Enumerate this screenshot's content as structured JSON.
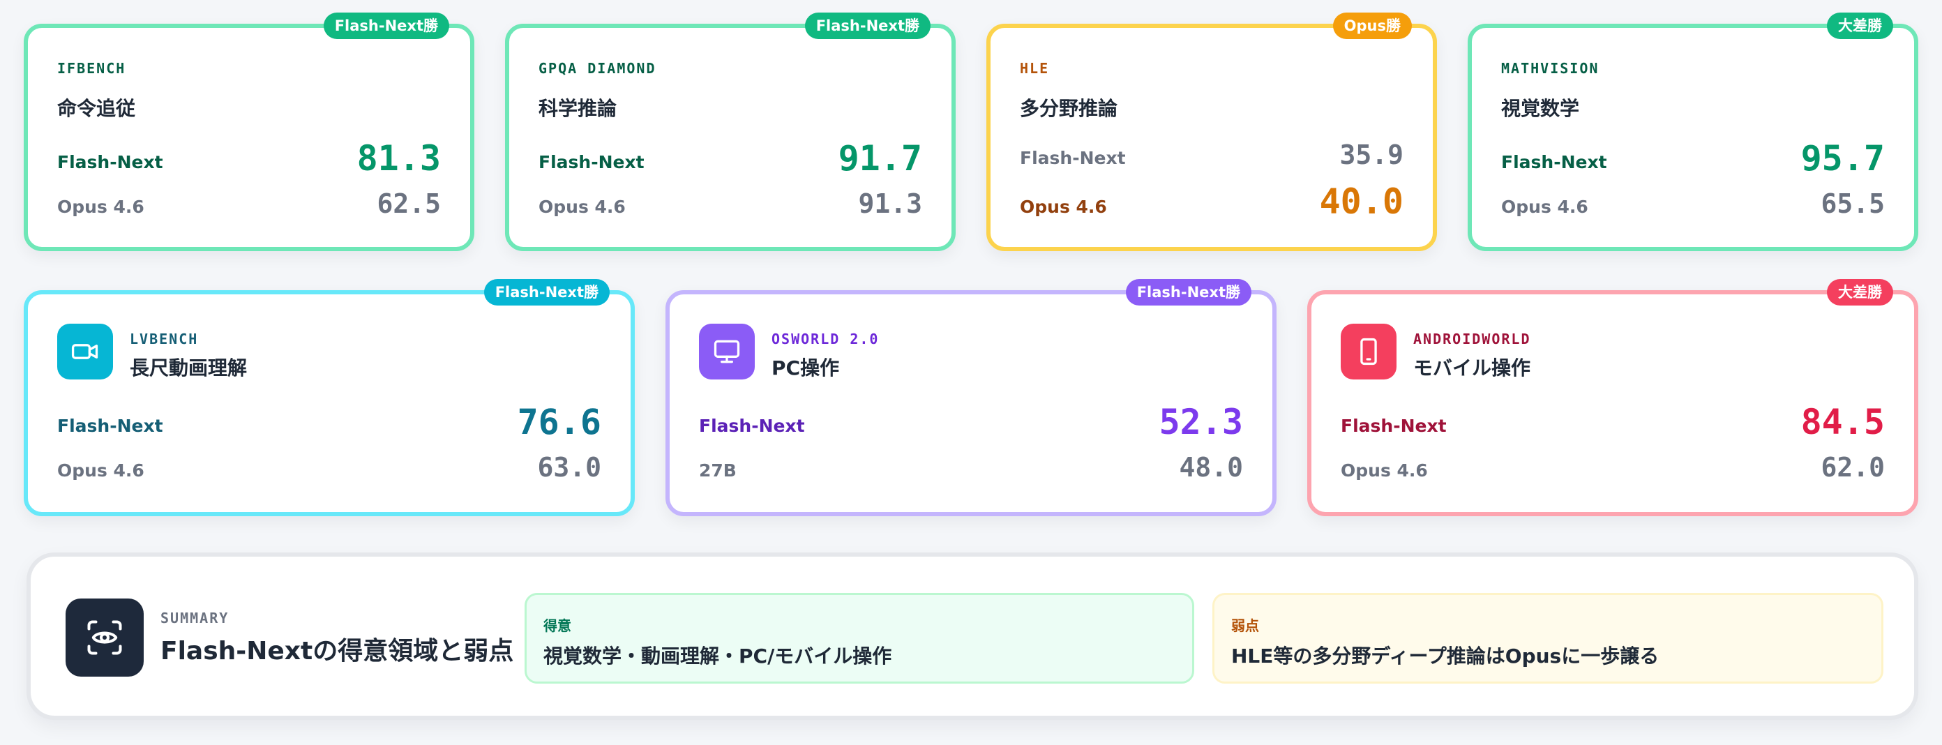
{
  "colors": {
    "green": "#10b981",
    "amber": "#f59e0b",
    "cyan": "#06b6d4",
    "purple": "#8b5cf6",
    "rose": "#f43f5e",
    "navy": "#1e293b"
  },
  "row1": [
    {
      "badge": "Flash-Next勝",
      "tag": "IFBENCH",
      "title": "命令追従",
      "rows": [
        {
          "label": "Flash-Next",
          "value": "81.3"
        },
        {
          "label": "Opus 4.6",
          "value": "62.5"
        }
      ]
    },
    {
      "badge": "Flash-Next勝",
      "tag": "GPQA DIAMOND",
      "title": "科学推論",
      "rows": [
        {
          "label": "Flash-Next",
          "value": "91.7"
        },
        {
          "label": "Opus 4.6",
          "value": "91.3"
        }
      ]
    },
    {
      "badge": "Opus勝",
      "tag": "HLE",
      "title": "多分野推論",
      "rows": [
        {
          "label": "Flash-Next",
          "value": "35.9"
        },
        {
          "label": "Opus 4.6",
          "value": "40.0"
        }
      ]
    },
    {
      "badge": "大差勝",
      "tag": "MATHVISION",
      "title": "視覚数学",
      "rows": [
        {
          "label": "Flash-Next",
          "value": "95.7"
        },
        {
          "label": "Opus 4.6",
          "value": "65.5"
        }
      ]
    }
  ],
  "row2": [
    {
      "badge": "Flash-Next勝",
      "icon": "video-camera-icon",
      "tag": "LVBENCH",
      "title": "長尺動画理解",
      "rows": [
        {
          "label": "Flash-Next",
          "value": "76.6"
        },
        {
          "label": "Opus 4.6",
          "value": "63.0"
        }
      ]
    },
    {
      "badge": "Flash-Next勝",
      "icon": "monitor-icon",
      "tag": "OSWORLD 2.0",
      "title": "PC操作",
      "rows": [
        {
          "label": "Flash-Next",
          "value": "52.3"
        },
        {
          "label": "27B",
          "value": "48.0"
        }
      ]
    },
    {
      "badge": "大差勝",
      "icon": "smartphone-icon",
      "tag": "ANDROIDWORLD",
      "title": "モバイル操作",
      "rows": [
        {
          "label": "Flash-Next",
          "value": "84.5"
        },
        {
          "label": "Opus 4.6",
          "value": "62.0"
        }
      ]
    }
  ],
  "summary": {
    "icon": "eye-scan-icon",
    "tag": "SUMMARY",
    "title": "Flash-Nextの得意領域と弱点",
    "strength": {
      "head": "得意",
      "body": "視覚数学・動画理解・PC/モバイル操作"
    },
    "weakness": {
      "head": "弱点",
      "body": "HLE等の多分野ディープ推論はOpusに一歩譲る"
    }
  }
}
